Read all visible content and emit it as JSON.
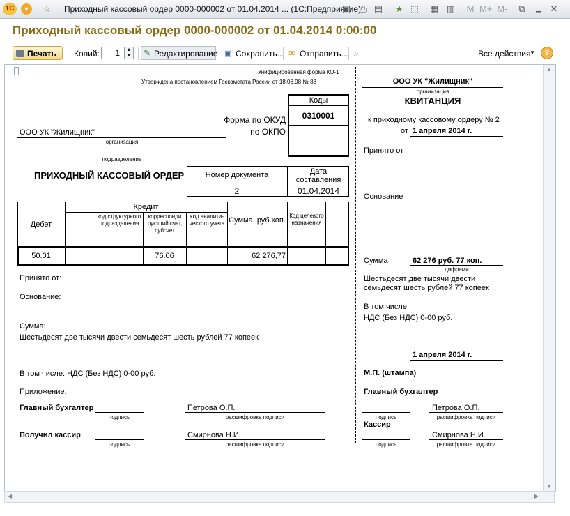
{
  "window": {
    "title": "Приходный кассовый ордер 0000-000002 от 01.04.2014 ... (1С:Предприятие)",
    "doc_title": "Приходный кассовый ордер 0000-000002 от 01.04.2014 0:00:00",
    "toolbar_right_icons": [
      "M",
      "M+",
      "M-"
    ]
  },
  "toolbar": {
    "print": "Печать",
    "copies_label": "Копий:",
    "copies_value": "1",
    "edit": "Редактирование",
    "save": "Сохранить...",
    "send": "Отправить...",
    "all_actions": "Все действия",
    "help": "?"
  },
  "form": {
    "unified": "Унифицированная форма КО-1",
    "approved": "Утверждена постановлением Госкомстата России от 18.08.98 № 88",
    "codes_label": "Коды",
    "okud_label": "Форма по ОКУД",
    "okud_value": "0310001",
    "okpo_label": "по ОКПО",
    "organization": "ООО УК \"Жилищник\"",
    "organization_caption": "организация",
    "subdivision_caption": "подразделение",
    "order_title": "ПРИХОДНЫЙ КАССОВЫЙ ОРДЕР",
    "doc_number_label": "Номер документа",
    "date_label": "Дата составления",
    "doc_number": "2",
    "doc_date": "01.04.2014",
    "table": {
      "debit": "Дебет",
      "credit": "Кредит",
      "struct": "код структурного подразделения",
      "corr": "корреспонди рующий счет, субсчет",
      "analytic": "код аналити- ческого учета",
      "sum": "Сумма, руб.коп.",
      "target": "Код целевого назначения",
      "row_debit": "50.01",
      "row_corr": "76.06",
      "row_sum": "62 276,77"
    },
    "received_from": "Принято от:",
    "basis": "Основание:",
    "sum_label": "Сумма:",
    "sum_words": "Шестьдесят две тысячи двести семьдесят шесть рублей 77 копеек",
    "incl": "В том числе: НДС (Без НДС) 0-00 руб.",
    "attachment": "Приложение:",
    "chief_acc": "Главный бухгалтер",
    "signature_caption": "подпись",
    "decoding_caption": "расшифровка подписи",
    "chief_name": "Петрова О.П.",
    "cashier_label": "Получил кассир",
    "cashier_name": "Смирнова Н.И."
  },
  "receipt": {
    "organization": "ООО УК \"Жилищник\"",
    "org_caption": "организация",
    "title": "КВИТАНЦИЯ",
    "to_order": "к приходному кассовому ордеру № 2",
    "from_label": "от",
    "date": "1 апреля 2014 г.",
    "received_from": "Принято от",
    "basis": "Основание",
    "sum_label": "Сумма",
    "sum_value": "62 276 руб. 77 коп.",
    "digits_caption": "цифрами",
    "sum_words_1": "Шестьдесят две тысячи двести",
    "sum_words_2": "семьдесят шесть рублей 77 копеек",
    "incl": "В том числе",
    "vat": "НДС (Без НДС) 0-00 руб.",
    "date2": "1 апреля 2014 г.",
    "stamp": "М.П. (штампа)",
    "chief_acc": "Главный бухгалтер",
    "signature_caption": "подпись",
    "decoding_caption": "расшифровка подписи",
    "chief_name": "Петрова О.П.",
    "cashier": "Кассир",
    "cashier_name": "Смирнова Н.И."
  }
}
